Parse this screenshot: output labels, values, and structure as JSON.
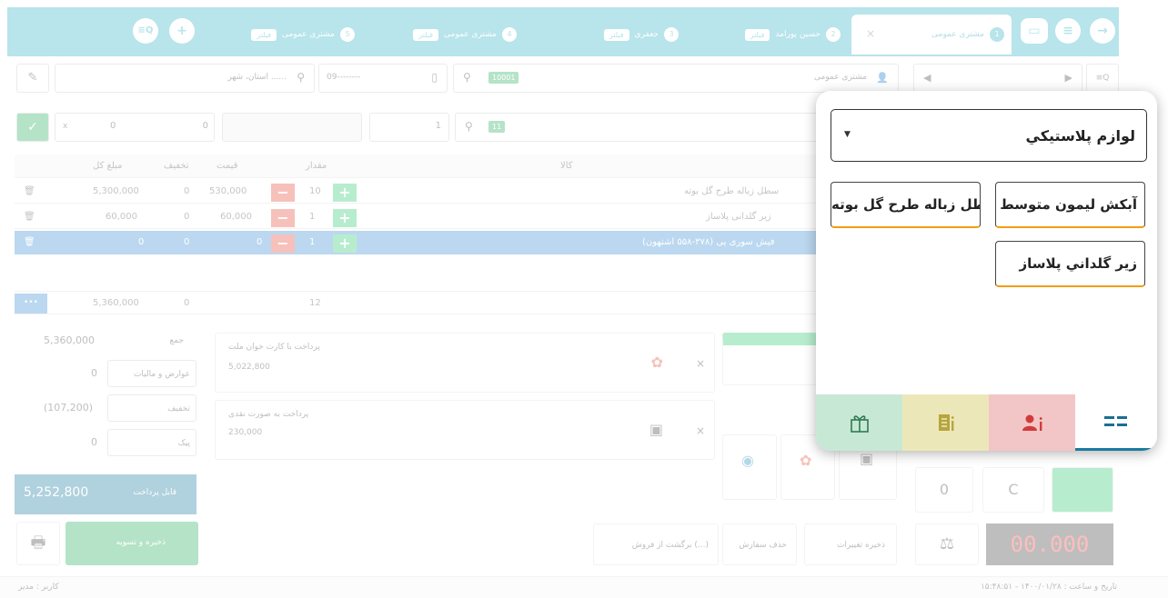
{
  "tabs": [
    {
      "num": "1",
      "label": "مشتری عمومی",
      "badge": "",
      "active": true
    },
    {
      "num": "2",
      "label": "حسین پورامد",
      "badge": "فیلتر",
      "active": false
    },
    {
      "num": "3",
      "label": "جعفری",
      "badge": "فیلتر",
      "active": false
    },
    {
      "num": "4",
      "label": "مشتری عمومی",
      "badge": "فیلتر",
      "active": false
    },
    {
      "num": "5",
      "label": "مشتری عمومی",
      "badge": "فیلتر",
      "active": false
    }
  ],
  "topbar": {
    "user_label": "مشتری عمومی",
    "code_tag": "10001",
    "phone_placeholder": "09--------",
    "location_placeholder": "استان، شهر ......"
  },
  "entry": {
    "count_tag": "11",
    "qty": "1",
    "a": "0",
    "b": "0",
    "x": "x"
  },
  "grid": {
    "headers": {
      "sum": "مبلغ کل",
      "discount": "تخفیف",
      "price": "قیمت",
      "qty": "مقدار",
      "name": "کالا"
    },
    "rows": [
      {
        "sum": "5,300,000",
        "disc": "0",
        "price": "530,000",
        "qty": "10",
        "name": "سطل زباله طرح گل بوته"
      },
      {
        "sum": "60,000",
        "disc": "0",
        "price": "60,000",
        "qty": "1",
        "name": "زیر گلدانی پلاساز"
      },
      {
        "sum": "0",
        "disc": "0",
        "price": "0",
        "qty": "1",
        "name": "فیش سوری پی (۳۷۸-۵۵۸ اشتهون)"
      }
    ],
    "totals": {
      "more": "•••",
      "sum": "5,360,000",
      "disc": "0",
      "qty": "12"
    }
  },
  "summary": {
    "total_label": "جمع",
    "total": "5,360,000",
    "tax_label": "عوارض و مالیات",
    "tax": "0",
    "discount_label": "تخفیف",
    "discount": "(107,200)",
    "peak_label": "پیک",
    "peak": "0",
    "payable_label": "قابل پرداخت",
    "payable": "5,252,800",
    "save_label": "ذخیره و تسویه"
  },
  "payments": [
    {
      "title": "پرداخت با کارت خوان ملت",
      "amount": "5,022,800"
    },
    {
      "title": "پرداخت به صورت نقدی",
      "amount": "230,000"
    }
  ],
  "bottom": {
    "save_changes": "ذخیره تغییرات",
    "delete_order": "حذف سفارش",
    "return_sale": "برگشت از فروش (...)",
    "status": "تاریخ و ساعت : ۱۴۰۰/۰۱/۲۸ - ۱۵:۴۸:۵۱",
    "user": "کاربر : مدیر",
    "display": "00.000"
  },
  "popup": {
    "category": "لوازم پلاستیکي",
    "items": [
      "آبکش ليمون متوسط",
      "سطل زباله طرح گل بوته",
      "زير گلداني پلاساز"
    ],
    "tab_colors": {
      "menu": "#ffffff",
      "user": "#f2c6c6",
      "invoice": "#ece7b8",
      "gift": "#c8e8d6"
    }
  }
}
